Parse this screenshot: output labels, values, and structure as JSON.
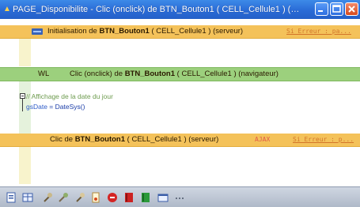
{
  "window": {
    "title": "PAGE_Disponibilite - Clic (onclick) de BTN_Bouton1 ( CELL_Cellule1 ) (naviga..."
  },
  "sections": {
    "init": {
      "prefix": "Initialisation de ",
      "control": "BTN_Bouton1",
      "suffix": " ( CELL_Cellule1 ) (serveur)",
      "extra": "Si Erreur : pa..."
    },
    "click_browser": {
      "tag": "WL",
      "prefix": "Clic (onclick) de ",
      "control": "BTN_Bouton1",
      "suffix": " ( CELL_Cellule1 ) (navigateur)"
    },
    "click_server": {
      "prefix": "Clic de ",
      "control": "BTN_Bouton1",
      "suffix": " ( CELL_Cellule1 ) (serveur)",
      "ajax": "AJAX",
      "extra": "Si Erreur : p..."
    }
  },
  "code": {
    "comment": "// Affichage de la date du jour",
    "var": "gsDate",
    "op": " = ",
    "func": "DateSys()"
  },
  "toolbar_icons": [
    "page-icon",
    "table-icon",
    "tool-icon",
    "wrench-icon",
    "tool-icon",
    "doc-icon",
    "stop-icon",
    "book-icon",
    "green-book-icon",
    "window-icon",
    "dots-icon"
  ],
  "colors": {
    "title_bar": "#2a6bd6",
    "gold_band": "#f4c25a",
    "green_band": "#9cd07d",
    "link": "#d2752a"
  }
}
